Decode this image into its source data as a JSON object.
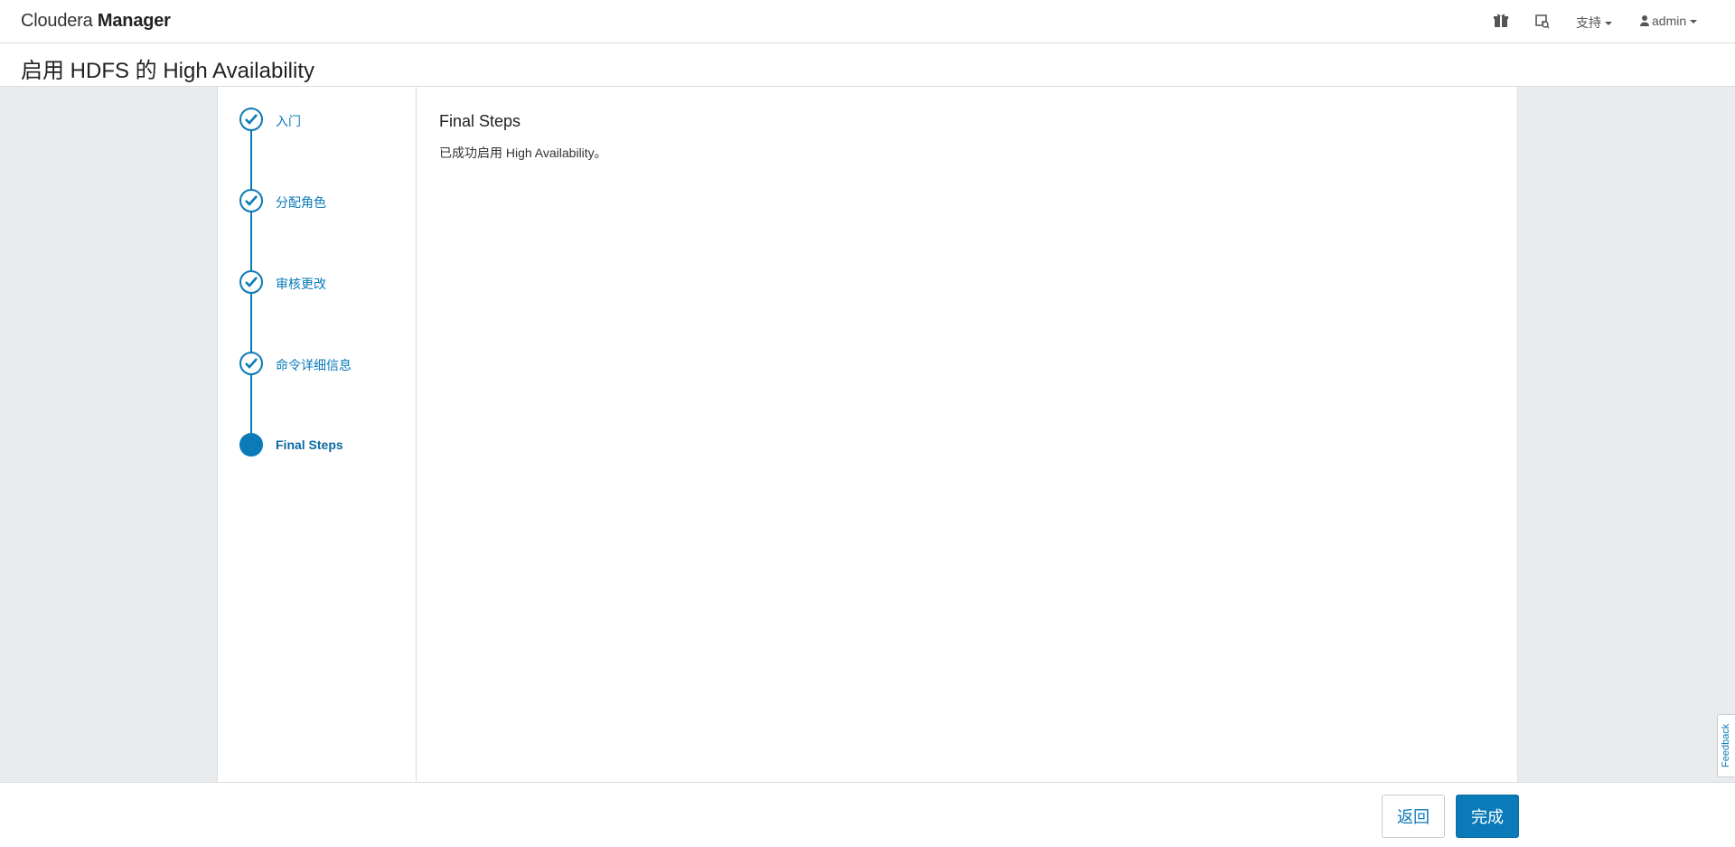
{
  "navbar": {
    "brand_light": "Cloudera ",
    "brand_bold": "Manager",
    "icons": [
      "gift-icon",
      "parcel-icon"
    ],
    "support_label": "支持",
    "user_label": "admin"
  },
  "page": {
    "title": "启用 HDFS 的 High Availability"
  },
  "steps": [
    {
      "label": "入门",
      "status": "completed"
    },
    {
      "label": "分配角色",
      "status": "completed"
    },
    {
      "label": "审核更改",
      "status": "completed"
    },
    {
      "label": "命令详细信息",
      "status": "completed"
    },
    {
      "label": "Final Steps",
      "status": "active"
    }
  ],
  "content": {
    "heading": "Final Steps",
    "message": "已成功启用 High Availability。"
  },
  "footer": {
    "back_label": "返回",
    "finish_label": "完成"
  },
  "feedback_label": "Feedback",
  "colors": {
    "accent": "#0a7ab9",
    "background": "#e9ecef"
  }
}
